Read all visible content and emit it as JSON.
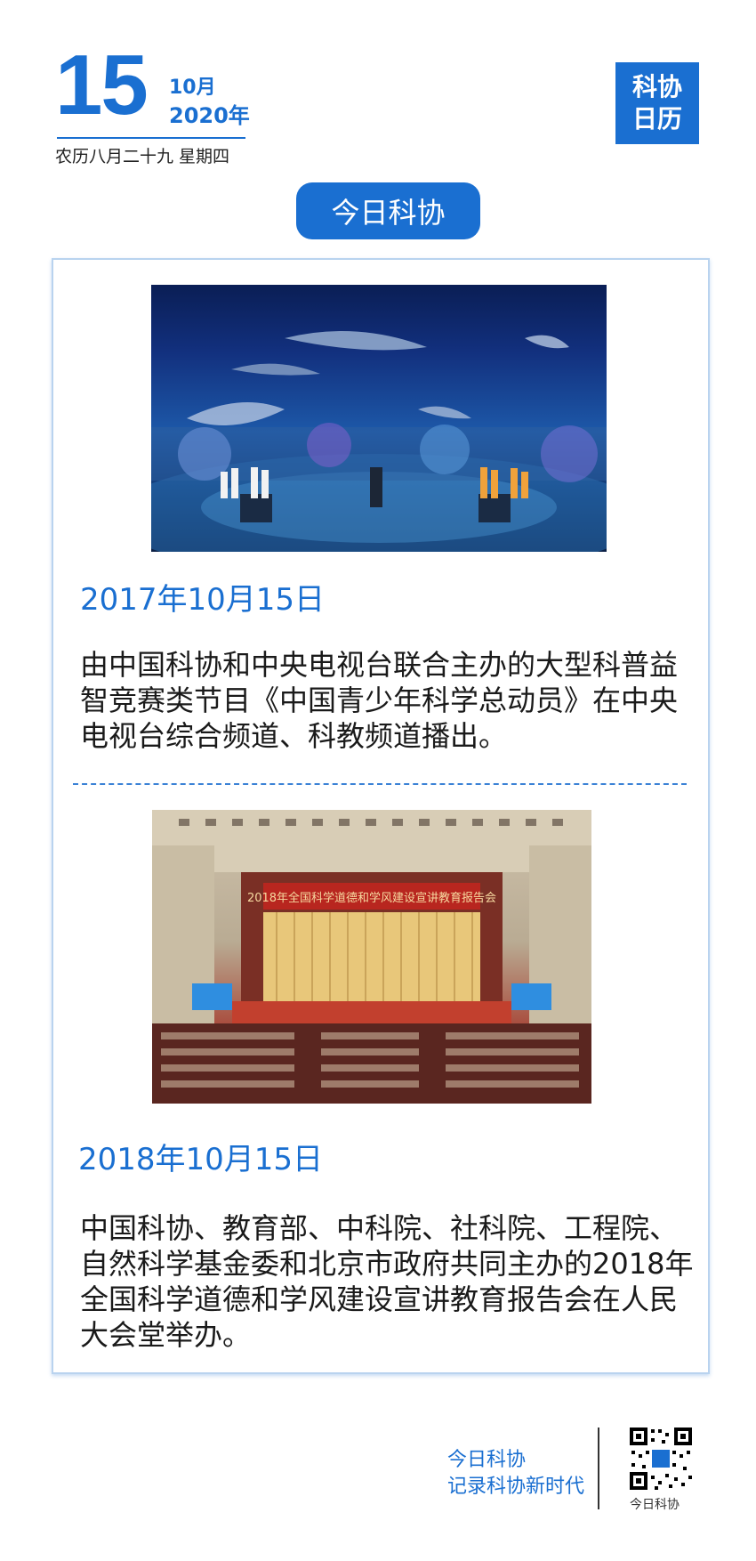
{
  "header": {
    "day": "15",
    "month": "10月",
    "year": "2020年",
    "lunar": "农历八月二十九  星期四",
    "badge_line1": "科协",
    "badge_line2": "日历"
  },
  "section_title": "今日科协",
  "entries": [
    {
      "date": "2017年10月15日",
      "text": "由中国科协和中央电视台联合主办的大型科普益智竞赛类节目《中国青少年科学总动员》在中央电视台综合频道、科教频道播出。"
    },
    {
      "date": "2018年10月15日",
      "text": "中国科协、教育部、中科院、社科院、工程院、自然科学基金委和北京市政府共同主办的2018年全国科学道德和学风建设宣讲教育报告会在人民大会堂举办。",
      "photo_banner": "2018年全国科学道德和学风建设宣讲教育报告会"
    }
  ],
  "footer": {
    "line1": "今日科协",
    "line2": "记录科协新时代",
    "qr_label": "今日科协"
  },
  "colors": {
    "accent": "#1a6fd1",
    "card_border": "#b9d3ef"
  }
}
